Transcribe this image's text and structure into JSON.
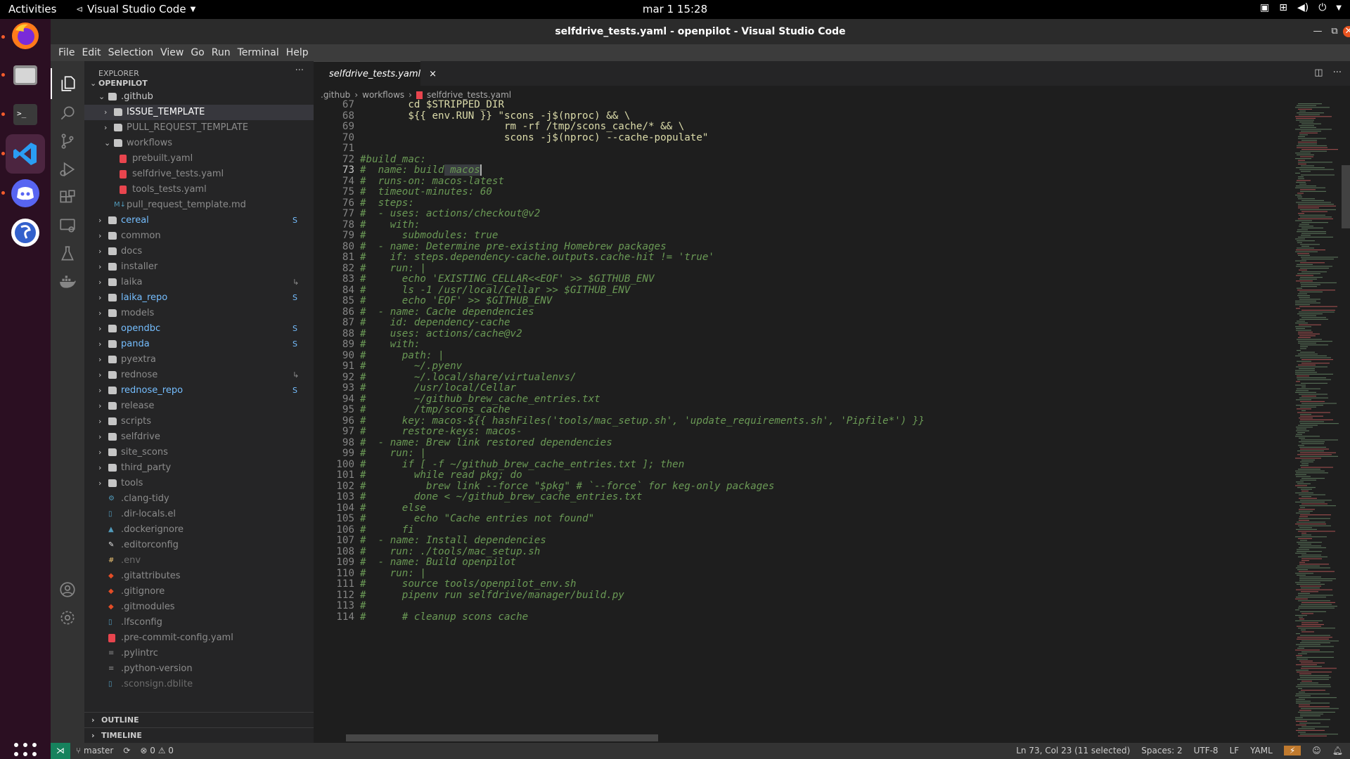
{
  "topbar": {
    "activities": "Activities",
    "app_name": "Visual Studio Code",
    "clock": "mar 1  15:28"
  },
  "window": {
    "title": "selfdrive_tests.yaml - openpilot - Visual Studio Code"
  },
  "menu": [
    "File",
    "Edit",
    "Selection",
    "View",
    "Go",
    "Run",
    "Terminal",
    "Help"
  ],
  "explorer": {
    "header": "EXPLORER",
    "project": "OPENPILOT",
    "outline": "OUTLINE",
    "timeline": "TIMELINE",
    "items": [
      {
        "label": ".github",
        "kind": "folder",
        "depth": 1,
        "open": true,
        "color": "#cccccc"
      },
      {
        "label": "ISSUE_TEMPLATE",
        "kind": "folder",
        "depth": 2,
        "open": false,
        "color": "#ffffff",
        "selected": true
      },
      {
        "label": "PULL_REQUEST_TEMPLATE",
        "kind": "folder",
        "depth": 2,
        "open": false,
        "color": "#8c8c8c"
      },
      {
        "label": "workflows",
        "kind": "folder",
        "depth": 2,
        "open": true,
        "color": "#8c8c8c"
      },
      {
        "label": "prebuilt.yaml",
        "kind": "yaml",
        "depth": 3,
        "color": "#8c8c8c"
      },
      {
        "label": "selfdrive_tests.yaml",
        "kind": "yaml",
        "depth": 3,
        "color": "#8c8c8c"
      },
      {
        "label": "tools_tests.yaml",
        "kind": "yaml",
        "depth": 3,
        "color": "#8c8c8c"
      },
      {
        "label": "pull_request_template.md",
        "kind": "md",
        "depth": 2,
        "color": "#8c8c8c"
      },
      {
        "label": "cereal",
        "kind": "folder",
        "depth": 1,
        "color": "#75beff",
        "badge": "S"
      },
      {
        "label": "common",
        "kind": "folder",
        "depth": 1,
        "color": "#8c8c8c"
      },
      {
        "label": "docs",
        "kind": "folder",
        "depth": 1,
        "color": "#8c8c8c"
      },
      {
        "label": "installer",
        "kind": "folder",
        "depth": 1,
        "color": "#8c8c8c"
      },
      {
        "label": "laika",
        "kind": "folder",
        "depth": 1,
        "color": "#8c8c8c",
        "badge": "↳"
      },
      {
        "label": "laika_repo",
        "kind": "folder",
        "depth": 1,
        "color": "#75beff",
        "badge": "S"
      },
      {
        "label": "models",
        "kind": "folder",
        "depth": 1,
        "color": "#8c8c8c"
      },
      {
        "label": "opendbc",
        "kind": "folder",
        "depth": 1,
        "color": "#75beff",
        "badge": "S"
      },
      {
        "label": "panda",
        "kind": "folder",
        "depth": 1,
        "color": "#75beff",
        "badge": "S"
      },
      {
        "label": "pyextra",
        "kind": "folder",
        "depth": 1,
        "color": "#8c8c8c"
      },
      {
        "label": "rednose",
        "kind": "folder",
        "depth": 1,
        "color": "#8c8c8c",
        "badge": "↳"
      },
      {
        "label": "rednose_repo",
        "kind": "folder",
        "depth": 1,
        "color": "#75beff",
        "badge": "S"
      },
      {
        "label": "release",
        "kind": "folder",
        "depth": 1,
        "color": "#8c8c8c"
      },
      {
        "label": "scripts",
        "kind": "folder",
        "depth": 1,
        "color": "#8c8c8c"
      },
      {
        "label": "selfdrive",
        "kind": "folder",
        "depth": 1,
        "color": "#8c8c8c"
      },
      {
        "label": "site_scons",
        "kind": "folder",
        "depth": 1,
        "color": "#8c8c8c"
      },
      {
        "label": "third_party",
        "kind": "folder",
        "depth": 1,
        "color": "#8c8c8c"
      },
      {
        "label": "tools",
        "kind": "folder",
        "depth": 1,
        "color": "#8c8c8c"
      },
      {
        "label": ".clang-tidy",
        "kind": "gear",
        "depth": 1,
        "color": "#8c8c8c"
      },
      {
        "label": ".dir-locals.el",
        "kind": "file",
        "depth": 1,
        "color": "#8c8c8c"
      },
      {
        "label": ".dockerignore",
        "kind": "docker",
        "depth": 1,
        "color": "#8c8c8c"
      },
      {
        "label": ".editorconfig",
        "kind": "editorconfig",
        "depth": 1,
        "color": "#8c8c8c"
      },
      {
        "label": ".env",
        "kind": "env",
        "depth": 1,
        "color": "#6c6c6c"
      },
      {
        "label": ".gitattributes",
        "kind": "git",
        "depth": 1,
        "color": "#8c8c8c"
      },
      {
        "label": ".gitignore",
        "kind": "git",
        "depth": 1,
        "color": "#8c8c8c"
      },
      {
        "label": ".gitmodules",
        "kind": "git",
        "depth": 1,
        "color": "#8c8c8c"
      },
      {
        "label": ".lfsconfig",
        "kind": "file",
        "depth": 1,
        "color": "#8c8c8c"
      },
      {
        "label": ".pre-commit-config.yaml",
        "kind": "yaml",
        "depth": 1,
        "color": "#8c8c8c"
      },
      {
        "label": ".pylintrc",
        "kind": "text",
        "depth": 1,
        "color": "#8c8c8c"
      },
      {
        "label": ".python-version",
        "kind": "text",
        "depth": 1,
        "color": "#8c8c8c"
      },
      {
        "label": ".sconsign.dblite",
        "kind": "file",
        "depth": 1,
        "color": "#6c6c6c"
      }
    ]
  },
  "tab": {
    "label": "selfdrive_tests.yaml",
    "close": "×"
  },
  "breadcrumb": [
    ".github",
    "workflows",
    "selfdrive_tests.yaml"
  ],
  "code": {
    "current_line": 73,
    "lines": [
      {
        "n": 67,
        "t": "        cd $STRIPPED_DIR",
        "s": "y"
      },
      {
        "n": 68,
        "t": "        ${{ env.RUN }} \"scons -j$(nproc) && \\",
        "s": "y"
      },
      {
        "n": 69,
        "t": "                        rm -rf /tmp/scons_cache/* && \\",
        "s": "y"
      },
      {
        "n": 70,
        "t": "                        scons -j$(nproc) --cache-populate\"",
        "s": "y"
      },
      {
        "n": 71,
        "t": "",
        "s": "c"
      },
      {
        "n": 72,
        "t": "#build_mac:",
        "s": "c"
      },
      {
        "n": 73,
        "t": "#  name: build macos",
        "s": "c",
        "hl_from": 14,
        "hl_to": 25
      },
      {
        "n": 74,
        "t": "#  runs-on: macos-latest",
        "s": "c"
      },
      {
        "n": 75,
        "t": "#  timeout-minutes: 60",
        "s": "c"
      },
      {
        "n": 76,
        "t": "#  steps:",
        "s": "c"
      },
      {
        "n": 77,
        "t": "#  - uses: actions/checkout@v2",
        "s": "c"
      },
      {
        "n": 78,
        "t": "#    with:",
        "s": "c"
      },
      {
        "n": 79,
        "t": "#      submodules: true",
        "s": "c"
      },
      {
        "n": 80,
        "t": "#  - name: Determine pre-existing Homebrew packages",
        "s": "c"
      },
      {
        "n": 81,
        "t": "#    if: steps.dependency-cache.outputs.cache-hit != 'true'",
        "s": "c"
      },
      {
        "n": 82,
        "t": "#    run: |",
        "s": "c"
      },
      {
        "n": 83,
        "t": "#      echo 'EXISTING_CELLAR<<EOF' >> $GITHUB_ENV",
        "s": "c"
      },
      {
        "n": 84,
        "t": "#      ls -1 /usr/local/Cellar >> $GITHUB_ENV",
        "s": "c"
      },
      {
        "n": 85,
        "t": "#      echo 'EOF' >> $GITHUB_ENV",
        "s": "c"
      },
      {
        "n": 86,
        "t": "#  - name: Cache dependencies",
        "s": "c"
      },
      {
        "n": 87,
        "t": "#    id: dependency-cache",
        "s": "c"
      },
      {
        "n": 88,
        "t": "#    uses: actions/cache@v2",
        "s": "c"
      },
      {
        "n": 89,
        "t": "#    with:",
        "s": "c"
      },
      {
        "n": 90,
        "t": "#      path: |",
        "s": "c"
      },
      {
        "n": 91,
        "t": "#        ~/.pyenv",
        "s": "c"
      },
      {
        "n": 92,
        "t": "#        ~/.local/share/virtualenvs/",
        "s": "c"
      },
      {
        "n": 93,
        "t": "#        /usr/local/Cellar",
        "s": "c"
      },
      {
        "n": 94,
        "t": "#        ~/github_brew_cache_entries.txt",
        "s": "c"
      },
      {
        "n": 95,
        "t": "#        /tmp/scons_cache",
        "s": "c"
      },
      {
        "n": 96,
        "t": "#      key: macos-${{ hashFiles('tools/mac_setup.sh', 'update_requirements.sh', 'Pipfile*') }}",
        "s": "c"
      },
      {
        "n": 97,
        "t": "#      restore-keys: macos-",
        "s": "c"
      },
      {
        "n": 98,
        "t": "#  - name: Brew link restored dependencies",
        "s": "c"
      },
      {
        "n": 99,
        "t": "#    run: |",
        "s": "c"
      },
      {
        "n": 100,
        "t": "#      if [ -f ~/github_brew_cache_entries.txt ]; then",
        "s": "c"
      },
      {
        "n": 101,
        "t": "#        while read pkg; do",
        "s": "c"
      },
      {
        "n": 102,
        "t": "#          brew link --force \"$pkg\" # `--force` for keg-only packages",
        "s": "c"
      },
      {
        "n": 103,
        "t": "#        done < ~/github_brew_cache_entries.txt",
        "s": "c"
      },
      {
        "n": 104,
        "t": "#      else",
        "s": "c"
      },
      {
        "n": 105,
        "t": "#        echo \"Cache entries not found\"",
        "s": "c"
      },
      {
        "n": 106,
        "t": "#      fi",
        "s": "c"
      },
      {
        "n": 107,
        "t": "#  - name: Install dependencies",
        "s": "c"
      },
      {
        "n": 108,
        "t": "#    run: ./tools/mac_setup.sh",
        "s": "c"
      },
      {
        "n": 109,
        "t": "#  - name: Build openpilot",
        "s": "c"
      },
      {
        "n": 110,
        "t": "#    run: |",
        "s": "c"
      },
      {
        "n": 111,
        "t": "#      source tools/openpilot_env.sh",
        "s": "c"
      },
      {
        "n": 112,
        "t": "#      pipenv run selfdrive/manager/build.py",
        "s": "c"
      },
      {
        "n": 113,
        "t": "#",
        "s": "c"
      },
      {
        "n": 114,
        "t": "#      # cleanup scons cache",
        "s": "c"
      }
    ]
  },
  "status": {
    "branch": "master",
    "problems": "⊗ 0 ⚠ 0",
    "cursor": "Ln 73, Col 23 (11 selected)",
    "spaces": "Spaces: 2",
    "encoding": "UTF-8",
    "eol": "LF",
    "language": "YAML"
  },
  "colors": {
    "accent_remote": "#16825d",
    "status_bg": "#333333",
    "yaml_icon": "#e8454e"
  }
}
